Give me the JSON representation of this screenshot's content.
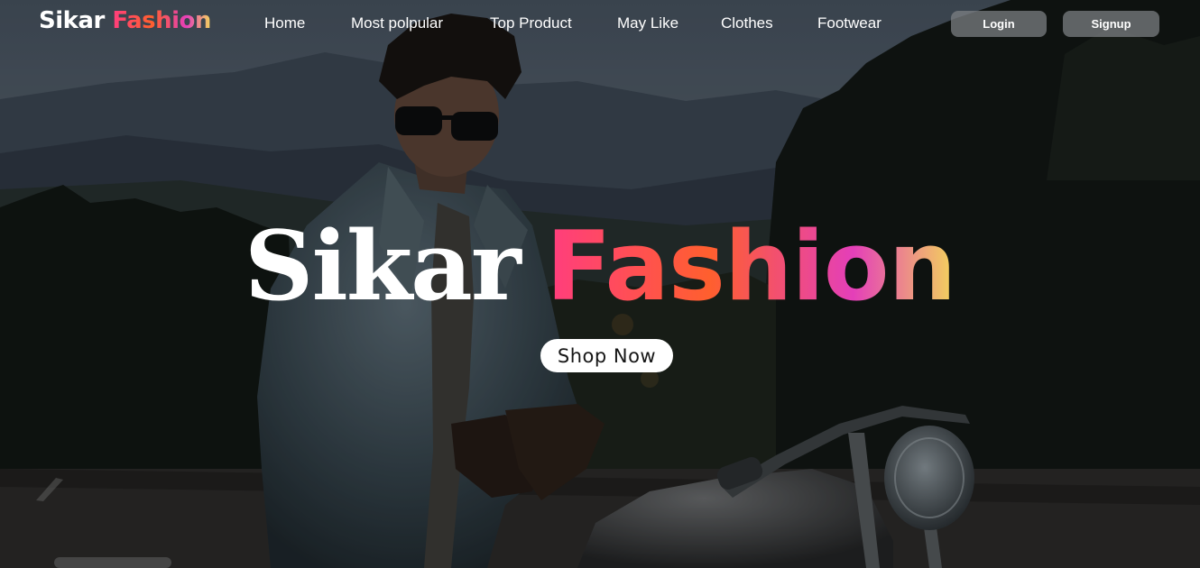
{
  "brand": {
    "part1": "Sikar",
    "part2": "Fashion"
  },
  "nav": {
    "items": [
      {
        "label": "Home"
      },
      {
        "label": "Most polpular"
      },
      {
        "label": "Top Product"
      },
      {
        "label": "May Like"
      },
      {
        "label": "Clothes"
      },
      {
        "label": "Footwear"
      }
    ],
    "login_label": "Login",
    "signup_label": "Signup"
  },
  "hero": {
    "title_part1": "Sikar",
    "title_part2": "Fashion",
    "cta_label": "Shop Now"
  },
  "colors": {
    "gradient_pink": "#ff3d7f",
    "gradient_orange": "#ff5f2e",
    "gradient_magenta": "#e43fb9",
    "gradient_yellow": "#f3d55b",
    "nav_button_bg": "#808286",
    "cta_bg": "#ffffff"
  }
}
